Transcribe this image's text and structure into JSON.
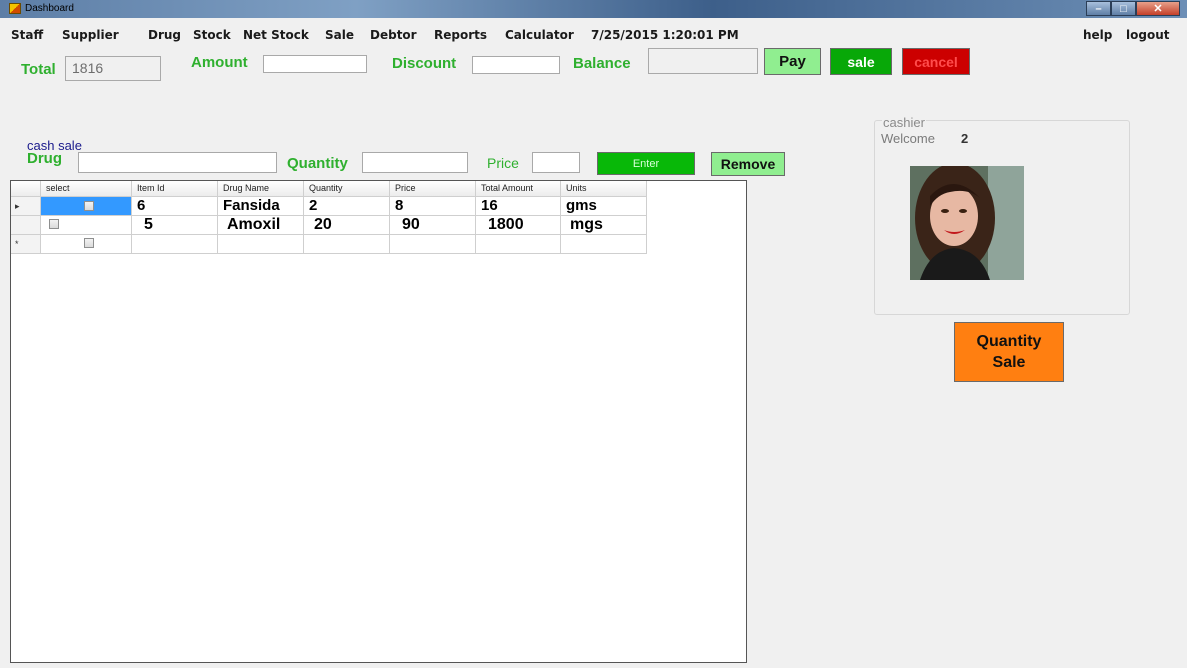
{
  "window": {
    "title": "Dashboard"
  },
  "menu": {
    "items": [
      "Staff",
      "Supplier",
      "Drug",
      "Stock",
      "Net Stock",
      "Sale",
      "Debtor",
      "Reports",
      "Calculator"
    ],
    "datetime": "7/25/2015 1:20:01 PM",
    "help": "help",
    "logout": "logout"
  },
  "totals": {
    "total_label": "Total",
    "total_value": "1816",
    "amount_label": "Amount",
    "amount_value": "",
    "discount_label": "Discount",
    "discount_value": "",
    "balance_label": "Balance",
    "balance_value": "",
    "pay_label": "Pay",
    "sale_label": "sale",
    "cancel_label": "cancel"
  },
  "entry": {
    "group_label": "cash sale",
    "drug_label": "Drug",
    "drug_value": "",
    "quantity_label": "Quantity",
    "quantity_value": "",
    "price_label": "Price",
    "price_value": "",
    "enter_label": "Enter",
    "remove_label": "Remove"
  },
  "grid": {
    "columns": [
      "select",
      "Item Id",
      "Drug Name",
      "Quantity",
      "Price",
      "Total Amount",
      "Units"
    ],
    "rows": [
      {
        "marker": "▸",
        "item_id": "6",
        "drug": "Fansida",
        "quantity": "2",
        "price": "8",
        "total": "16",
        "units": "gms"
      },
      {
        "marker": "",
        "item_id": "5",
        "drug": "Amoxil",
        "quantity": "20",
        "price": "90",
        "total": "1800",
        "units": "mgs"
      },
      {
        "marker": "*",
        "item_id": "",
        "drug": "",
        "quantity": "",
        "price": "",
        "total": "",
        "units": ""
      }
    ]
  },
  "cashier": {
    "group_label": "cashier",
    "welcome_label": "Welcome",
    "user_id": "2"
  },
  "quantity_sale": {
    "line1": "Quantity",
    "line2": "Sale"
  },
  "colors": {
    "accent_green": "#2fb02f",
    "pay": "#90ee90",
    "sale": "#08a808",
    "cancel": "#cc0000",
    "enter": "#08b808",
    "remove": "#90ee90",
    "quantity_sale": "#ff7f11"
  }
}
